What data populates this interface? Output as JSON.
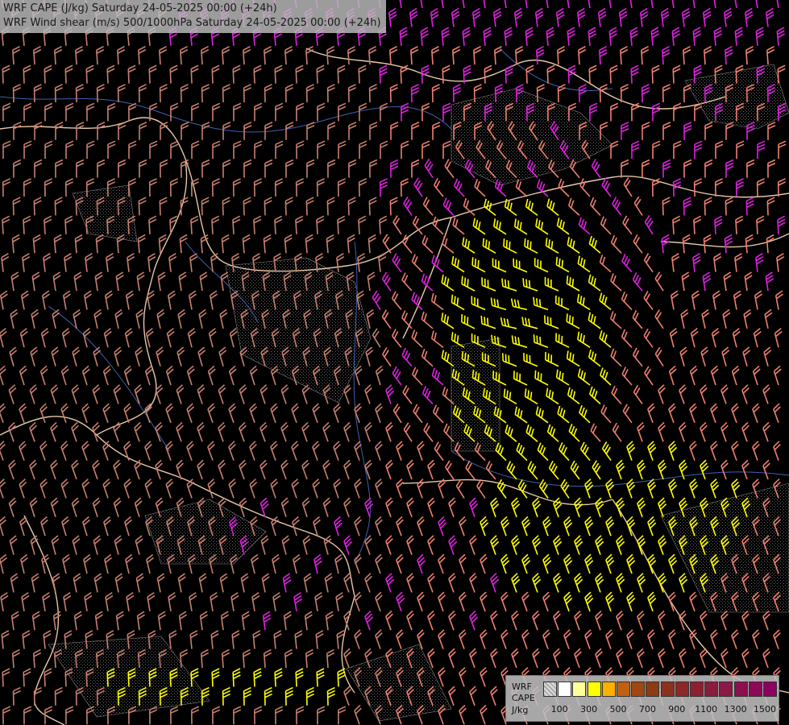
{
  "header": {
    "line1": "WRF CAPE (J/kg) Saturday 24-05-2025 00:00 (+24h)",
    "line2": "WRF Wind shear (m/s) 500/1000hPa Saturday 24-05-2025 00:00 (+24h)"
  },
  "legend": {
    "label_model": "WRF",
    "label_field": "CAPE",
    "label_unit": "J/kg",
    "ticks": [
      "100",
      "300",
      "500",
      "700",
      "900",
      "1100",
      "1300",
      "1500"
    ],
    "colors": [
      "#c8c8c8",
      "#ffffff",
      "#ffff99",
      "#ffff00",
      "#ffb000",
      "#c06010",
      "#a04810",
      "#8c3c14",
      "#8c3020",
      "#8c2828",
      "#8c2030",
      "#8c1c3c",
      "#8c1848",
      "#8c1050",
      "#8c0858",
      "#8c0060"
    ]
  },
  "palette": {
    "shear_low": "#c88070",
    "shear_mid": "#f08070",
    "shear_high": "#e020e0",
    "cape_high": "#ffff00",
    "border": "#e8c8a8",
    "river": "#4060b0",
    "terrain": "#a8a8a8"
  }
}
